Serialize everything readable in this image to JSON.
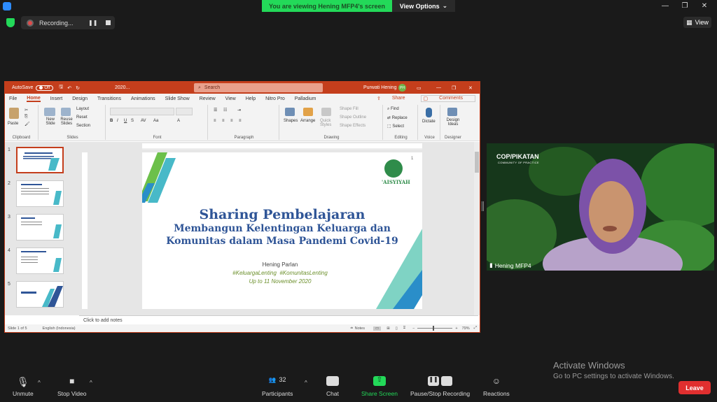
{
  "zoom": {
    "banner_text": "You are viewing Hening MFP4's screen",
    "view_options_label": "View Options",
    "recording_label": "Recording...",
    "view_label": "View",
    "colors": {
      "banner_green": "#23d959",
      "leave_red": "#e02f2f"
    }
  },
  "powerpoint": {
    "autosave_label": "AutoSave",
    "autosave_state": "Off",
    "file_name": "2020...",
    "search_placeholder": "Search",
    "user_name": "Purwati Hening",
    "user_initials": "PH",
    "menu": [
      "File",
      "Home",
      "Insert",
      "Design",
      "Transitions",
      "Animations",
      "Slide Show",
      "Review",
      "View",
      "Help",
      "Nitro Pro",
      "Palladium"
    ],
    "active_menu": "Home",
    "share_label": "Share",
    "comments_label": "Comments",
    "ribbon": {
      "clipboard": {
        "label": "Clipboard",
        "paste": "Paste"
      },
      "slides": {
        "label": "Slides",
        "new_slide": "New Slide",
        "reuse_slides": "Reuse Slides",
        "layout": "Layout",
        "reset": "Reset",
        "section": "Section"
      },
      "font": {
        "label": "Font"
      },
      "paragraph": {
        "label": "Paragraph"
      },
      "drawing": {
        "label": "Drawing",
        "shapes": "Shapes",
        "arrange": "Arrange",
        "quick_styles": "Quick Styles",
        "shape_fill": "Shape Fill",
        "shape_outline": "Shape Outline",
        "shape_effects": "Shape Effects"
      },
      "editing": {
        "label": "Editing",
        "find": "Find",
        "replace": "Replace",
        "select": "Select"
      },
      "voice": {
        "label": "Voice",
        "dictate": "Dictate"
      },
      "designer": {
        "label": "Designer",
        "design_ideas": "Design Ideas"
      }
    },
    "slide_numbers": [
      "1",
      "2",
      "3",
      "4",
      "5"
    ],
    "slide": {
      "page_number": "1",
      "logo_text": "'AISYIYAH",
      "title": "Sharing Pembelajaran",
      "subtitle_line1": "Membangun Kelentingan Keluarga dan",
      "subtitle_line2": "Komunitas dalam Masa Pandemi Covid-19",
      "presenter": "Hening Parlan",
      "hashtags": "#KeluargaLenting  #KomunitasLenting",
      "date_line": "Up to 11 November 2020"
    },
    "notes_placeholder": "Click to add notes",
    "status": {
      "slide_count": "Slide 1 of 5",
      "language": "English (Indonesia)",
      "notes_label": "Notes",
      "zoom_level": "79%"
    }
  },
  "video": {
    "participant_name": "Hening MFP4",
    "logo_text": "COP/PIKATAN",
    "logo_subtext": "COMMUNITY OF PRACTICE"
  },
  "toolbar": {
    "unmute": "Unmute",
    "stop_video": "Stop Video",
    "participants": "Participants",
    "participants_count": "32",
    "chat": "Chat",
    "share_screen": "Share Screen",
    "pause_stop_recording": "Pause/Stop Recording",
    "reactions": "Reactions",
    "leave": "Leave"
  },
  "watermark": {
    "line1": "Activate Windows",
    "line2": "Go to PC settings to activate Windows."
  }
}
